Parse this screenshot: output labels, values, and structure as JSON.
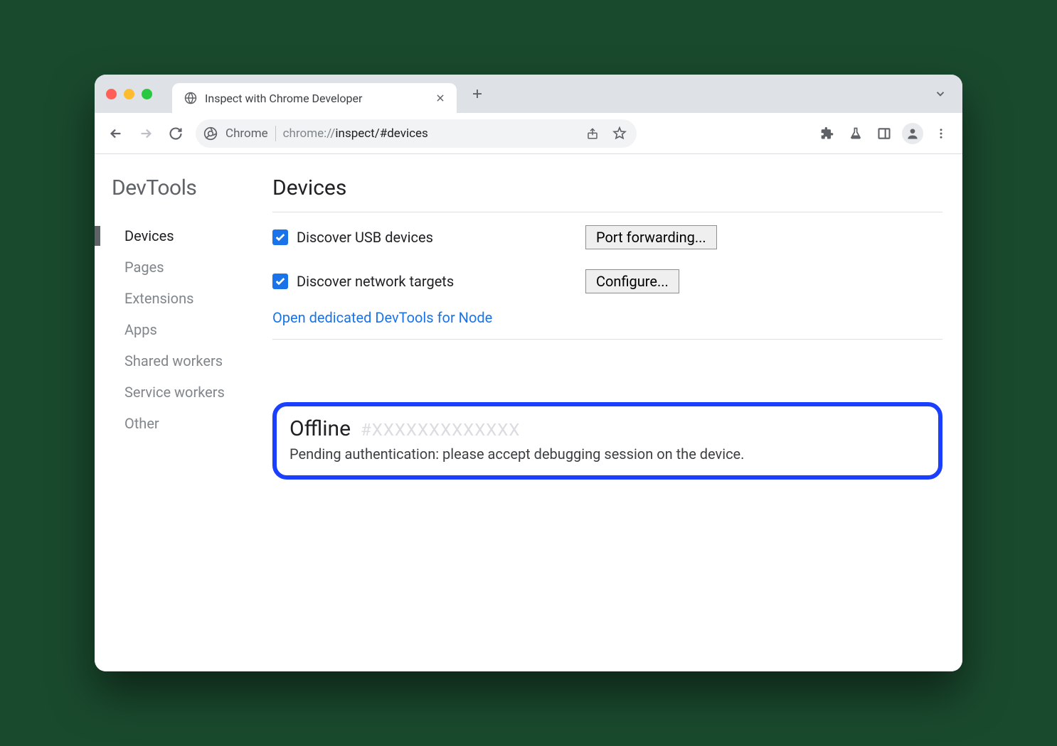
{
  "tab": {
    "title": "Inspect with Chrome Developer"
  },
  "omnibox": {
    "chip_label": "Chrome",
    "url_scheme": "chrome://",
    "url_path": "inspect/#devices"
  },
  "sidebar": {
    "title": "DevTools",
    "items": [
      {
        "label": "Devices",
        "active": true
      },
      {
        "label": "Pages"
      },
      {
        "label": "Extensions"
      },
      {
        "label": "Apps"
      },
      {
        "label": "Shared workers"
      },
      {
        "label": "Service workers"
      },
      {
        "label": "Other"
      }
    ]
  },
  "main": {
    "title": "Devices",
    "discover_usb_label": "Discover USB devices",
    "port_forwarding_btn": "Port forwarding...",
    "discover_network_label": "Discover network targets",
    "configure_btn": "Configure...",
    "open_dedicated_link": "Open dedicated DevTools for Node",
    "device": {
      "status": "Offline",
      "id": "#XXXXXXXXXXXXX",
      "message": "Pending authentication: please accept debugging session on the device."
    }
  }
}
